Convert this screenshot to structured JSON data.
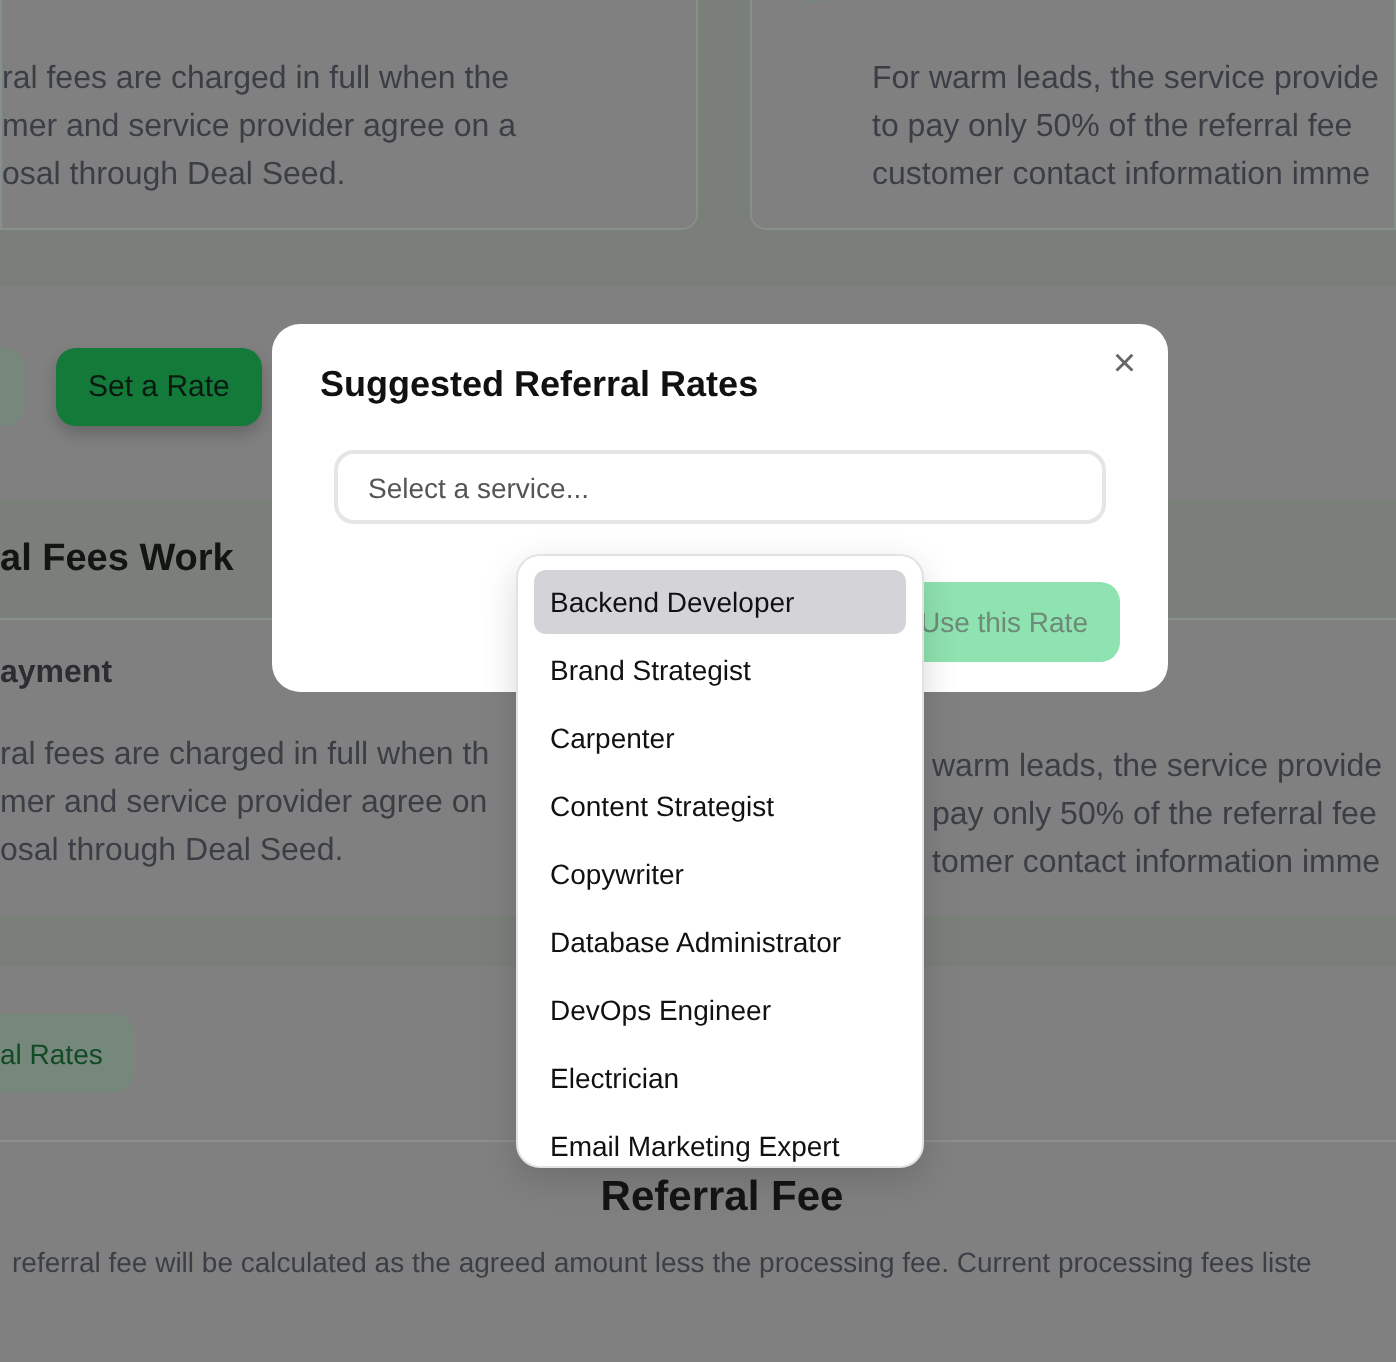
{
  "top_cards": [
    {
      "kind": "plain",
      "lines": [
        "ral fees are charged in full when the",
        "mer and service provider agree on a",
        "osal through Deal Seed."
      ]
    },
    {
      "kind": "icon",
      "lines": [
        "For warm leads, the service provide",
        "to pay only 50% of the referral fee",
        "customer contact information imme"
      ]
    }
  ],
  "actions": [
    {
      "label": "Set a Rate",
      "kind": "primary"
    }
  ],
  "fees_section": {
    "heading": "al Fees Work",
    "left": {
      "title": "ayment",
      "lines": [
        "ral fees are charged in full when th",
        "mer and service provider agree on",
        "osal through Deal Seed."
      ]
    },
    "right": {
      "lines": [
        "warm leads, the service provide",
        "pay only 50% of the referral fee",
        "tomer contact information imme"
      ]
    }
  },
  "rates_button": "al Rates",
  "referral_fee": {
    "heading": "Referral Fee",
    "text": "referral fee will be calculated as the agreed amount less the processing fee. Current processing fees liste"
  },
  "modal": {
    "title": "Suggested Referral Rates",
    "close": "×",
    "search": {
      "placeholder": "Select a service..."
    },
    "button": {
      "label": "Use this Rate",
      "disabled": true
    }
  },
  "dropdown": [
    {
      "label": "Backend Developer",
      "selected": true
    },
    {
      "label": "Brand Strategist",
      "selected": false
    },
    {
      "label": "Carpenter",
      "selected": false
    },
    {
      "label": "Content Strategist",
      "selected": false
    },
    {
      "label": "Copywriter",
      "selected": false
    },
    {
      "label": "Database Administrator",
      "selected": false
    },
    {
      "label": "DevOps Engineer",
      "selected": false
    },
    {
      "label": "Electrician",
      "selected": false
    },
    {
      "label": "Email Marketing Expert",
      "selected": false
    }
  ]
}
